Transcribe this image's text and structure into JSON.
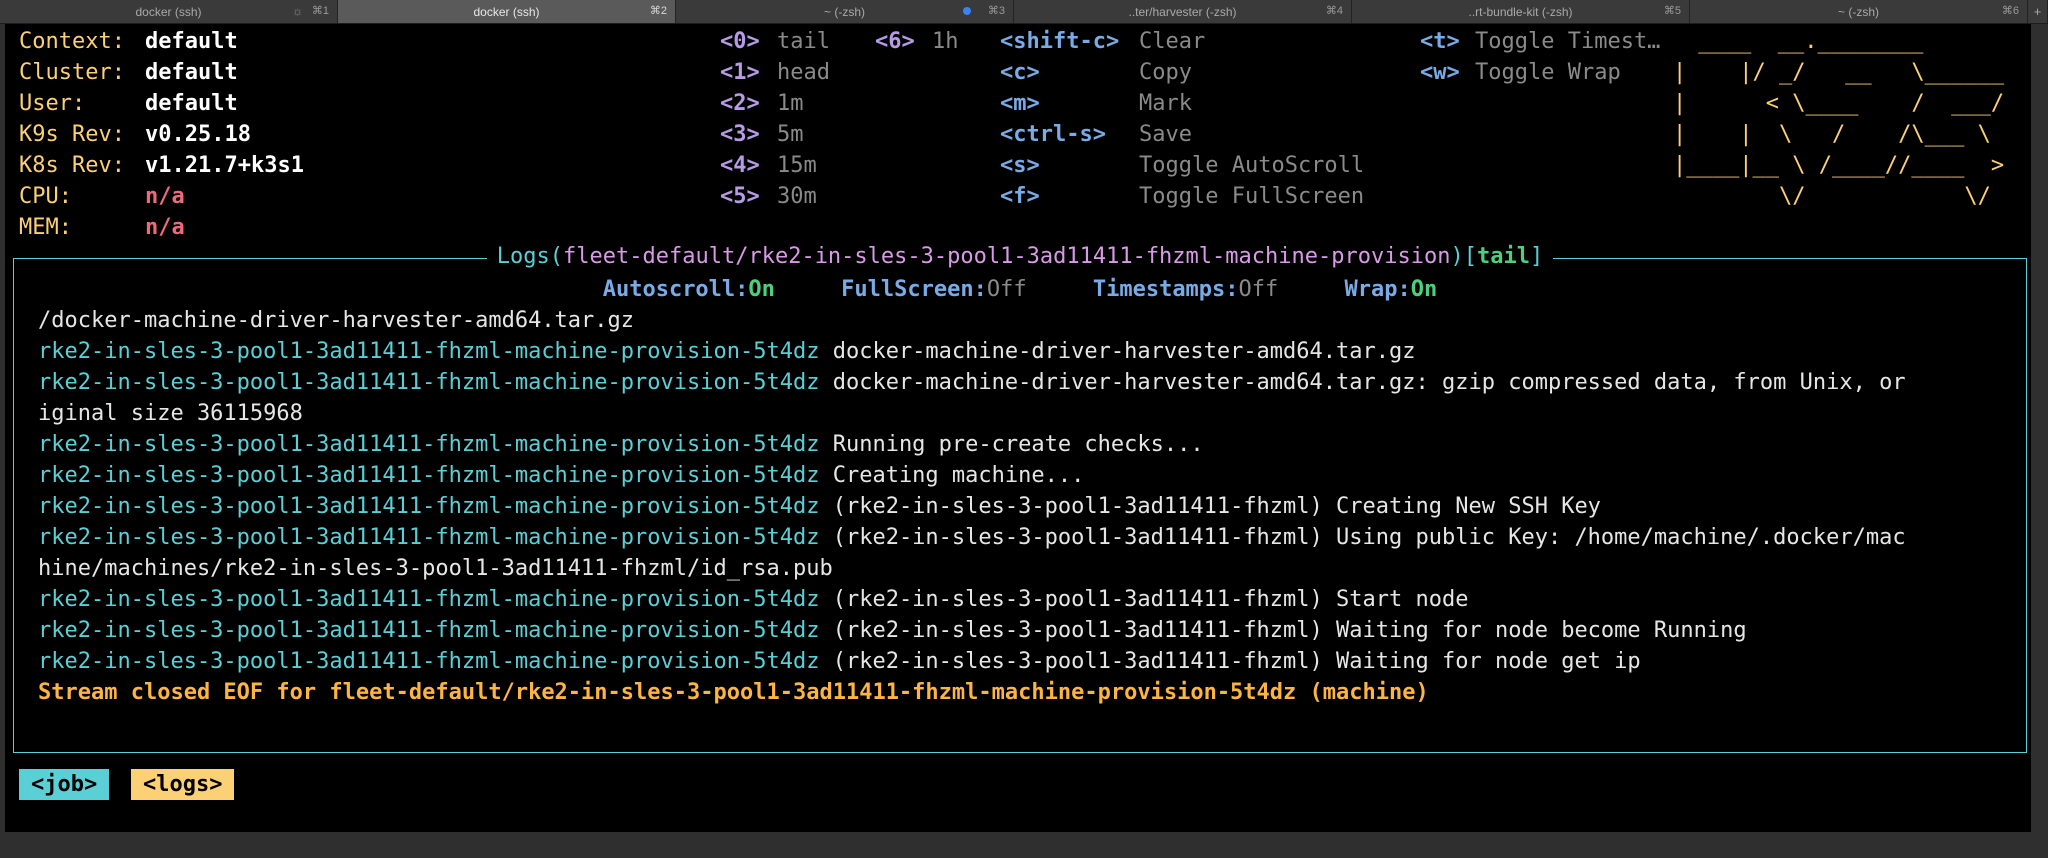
{
  "tabs": [
    {
      "label": "docker (ssh)",
      "shortcut": "⌘1",
      "spinner": "☼"
    },
    {
      "label": "docker (ssh)",
      "shortcut": "⌘2",
      "active": true
    },
    {
      "label": "~ (-zsh)",
      "shortcut": "⌘3",
      "dot": true
    },
    {
      "label": "..ter/harvester (-zsh)",
      "shortcut": "⌘4"
    },
    {
      "label": "..rt-bundle-kit (-zsh)",
      "shortcut": "⌘5"
    },
    {
      "label": "~ (-zsh)",
      "shortcut": "⌘6"
    }
  ],
  "new_tab_label": "+",
  "info": [
    {
      "label": "Context:",
      "value": "default",
      "style": "wht"
    },
    {
      "label": "Cluster:",
      "value": "default",
      "style": "wht"
    },
    {
      "label": "User:",
      "value": "default",
      "style": "wht"
    },
    {
      "label": "K9s Rev:",
      "value": "v0.25.18",
      "style": "wht"
    },
    {
      "label": "K8s Rev:",
      "value": "v1.21.7+k3s1",
      "style": "wht"
    },
    {
      "label": "CPU:",
      "value": "n/a",
      "style": "red"
    },
    {
      "label": "MEM:",
      "value": "n/a",
      "style": "red"
    }
  ],
  "hotkeys_col1": [
    {
      "key": "<0>",
      "label": "tail"
    },
    {
      "key": "<1>",
      "label": "head"
    },
    {
      "key": "<2>",
      "label": "1m"
    },
    {
      "key": "<3>",
      "label": "5m"
    },
    {
      "key": "<4>",
      "label": "15m"
    },
    {
      "key": "<5>",
      "label": "30m"
    }
  ],
  "hotkeys_col2": [
    {
      "key": "<6>",
      "label": "1h"
    }
  ],
  "hotkeys_col3": [
    {
      "key": "<shift-c>",
      "label": "Clear"
    },
    {
      "key": "<c>",
      "label": "Copy"
    },
    {
      "key": "<m>",
      "label": "Mark"
    },
    {
      "key": "<ctrl-s>",
      "label": "Save"
    },
    {
      "key": "<s>",
      "label": "Toggle AutoScroll"
    },
    {
      "key": "<f>",
      "label": "Toggle FullScreen"
    }
  ],
  "hotkeys_col4": [
    {
      "key": "<t>",
      "label": "Toggle Timest…"
    },
    {
      "key": "<w>",
      "label": "Toggle Wrap"
    }
  ],
  "logo_lines": [
    " ____  __.________",
    "|    |/ _/   __   \\______",
    "|      < \\____    /  ___/",
    "|    |  \\   /    /\\___ \\",
    "|____|__ \\ /____//____  >",
    "        \\/            \\/"
  ],
  "log_view": {
    "title_prefix": "Logs(",
    "title_path": "fleet-default/rke2-in-sles-3-pool1-3ad11411-fhzml-machine-provision",
    "title_suffix": ")[",
    "title_mode": "tail",
    "title_end": "]",
    "status": [
      {
        "label": "Autoscroll:",
        "value": "On",
        "on": true
      },
      {
        "label": "FullScreen:",
        "value": "Off",
        "on": false
      },
      {
        "label": "Timestamps:",
        "value": "Off",
        "on": false
      },
      {
        "label": "Wrap:",
        "value": "On",
        "on": true
      }
    ],
    "lines": [
      {
        "pod": "",
        "text": "/docker-machine-driver-harvester-amd64.tar.gz"
      },
      {
        "pod": "rke2-in-sles-3-pool1-3ad11411-fhzml-machine-provision-5t4dz",
        "text": " docker-machine-driver-harvester-amd64.tar.gz"
      },
      {
        "pod": "rke2-in-sles-3-pool1-3ad11411-fhzml-machine-provision-5t4dz",
        "text": " docker-machine-driver-harvester-amd64.tar.gz: gzip compressed data, from Unix, or"
      },
      {
        "pod": "",
        "text": "iginal size 36115968"
      },
      {
        "pod": "rke2-in-sles-3-pool1-3ad11411-fhzml-machine-provision-5t4dz",
        "text": " Running pre-create checks..."
      },
      {
        "pod": "rke2-in-sles-3-pool1-3ad11411-fhzml-machine-provision-5t4dz",
        "text": " Creating machine..."
      },
      {
        "pod": "rke2-in-sles-3-pool1-3ad11411-fhzml-machine-provision-5t4dz",
        "text": " (rke2-in-sles-3-pool1-3ad11411-fhzml) Creating New SSH Key"
      },
      {
        "pod": "rke2-in-sles-3-pool1-3ad11411-fhzml-machine-provision-5t4dz",
        "text": " (rke2-in-sles-3-pool1-3ad11411-fhzml) Using public Key: /home/machine/.docker/mac"
      },
      {
        "pod": "",
        "text": "hine/machines/rke2-in-sles-3-pool1-3ad11411-fhzml/id_rsa.pub"
      },
      {
        "pod": "rke2-in-sles-3-pool1-3ad11411-fhzml-machine-provision-5t4dz",
        "text": " (rke2-in-sles-3-pool1-3ad11411-fhzml) Start node"
      },
      {
        "pod": "rke2-in-sles-3-pool1-3ad11411-fhzml-machine-provision-5t4dz",
        "text": " (rke2-in-sles-3-pool1-3ad11411-fhzml) Waiting for node become Running"
      },
      {
        "pod": "rke2-in-sles-3-pool1-3ad11411-fhzml-machine-provision-5t4dz",
        "text": " (rke2-in-sles-3-pool1-3ad11411-fhzml) Waiting for node get ip"
      }
    ],
    "eof_line": "Stream closed EOF for fleet-default/rke2-in-sles-3-pool1-3ad11411-fhzml-machine-provision-5t4dz (machine)"
  },
  "crumbs": [
    {
      "label": "<job>"
    },
    {
      "label": "<logs>"
    }
  ],
  "colors": {
    "accent_cyan": "#5ad0d6",
    "accent_yellow": "#fcd176",
    "hotkey_purple": "#b79be6",
    "hotkey_blue": "#79abe6",
    "eof_orange": "#fcb443",
    "on_green": "#4cd07d",
    "alert_red": "#f0697a"
  }
}
